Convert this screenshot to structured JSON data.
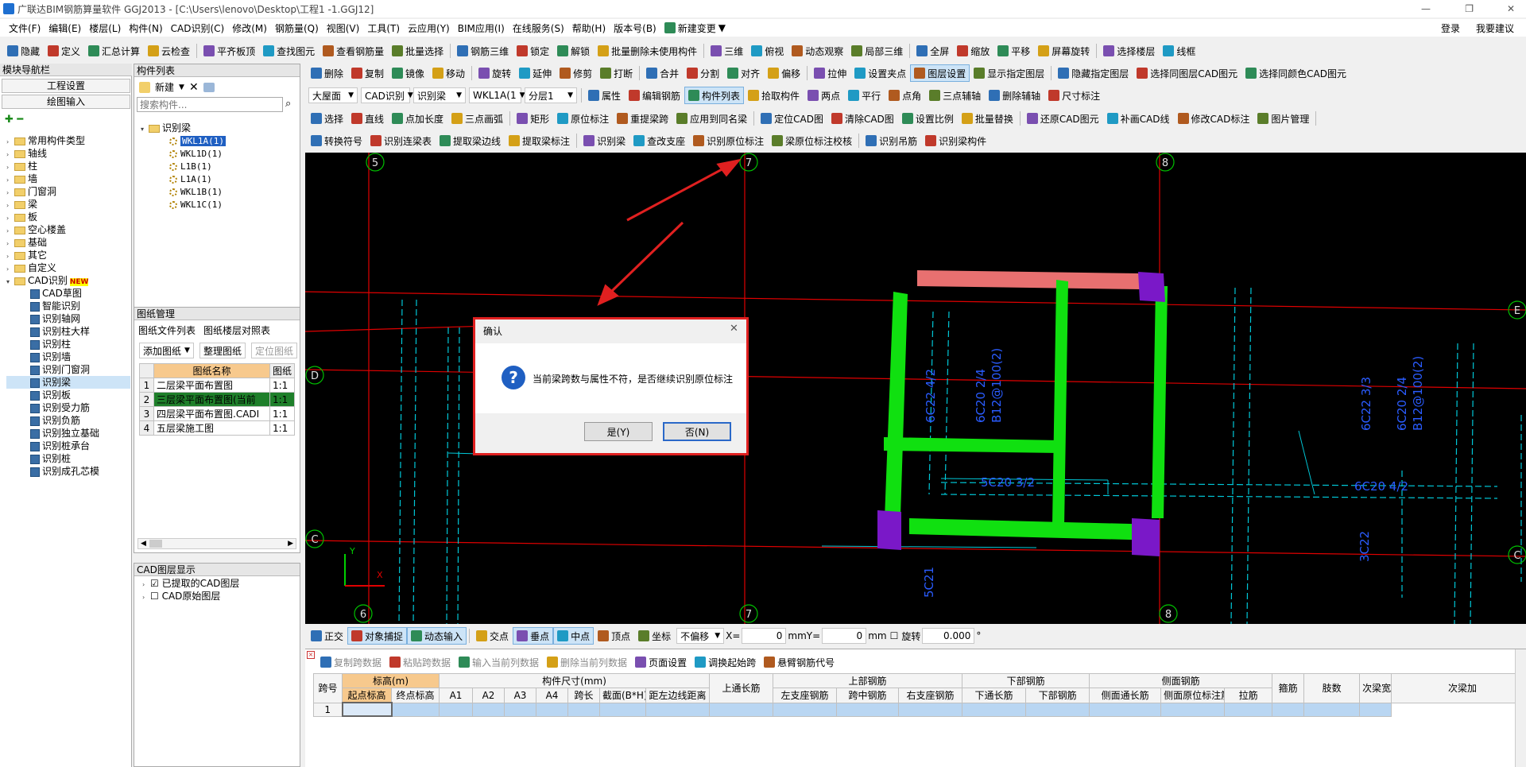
{
  "title": "广联达BIM钢筋算量软件 GGJ2013 - [C:\\Users\\lenovo\\Desktop\\工程1 -1.GGJ12]",
  "window_controls": {
    "min": "—",
    "max": "❐",
    "close": "✕"
  },
  "menu": [
    "文件(F)",
    "编辑(E)",
    "楼层(L)",
    "构件(N)",
    "CAD识别(C)",
    "修改(M)",
    "钢筋量(Q)",
    "视图(V)",
    "工具(T)",
    "云应用(Y)",
    "BIM应用(I)",
    "在线服务(S)",
    "帮助(H)",
    "版本号(B)"
  ],
  "menu_extra": "新建变更",
  "login": "登录",
  "feedback": "我要建议",
  "toolbar1": [
    "隐藏",
    "定义",
    "汇总计算",
    "云检查",
    "平齐板顶",
    "查找图元",
    "查看钢筋量",
    "批量选择",
    "钢筋三维",
    "锁定",
    "解锁",
    "批量删除未使用构件",
    "三维",
    "俯视",
    "动态观察",
    "局部三维",
    "全屏",
    "缩放",
    "平移",
    "屏幕旋转",
    "选择楼层",
    "线框"
  ],
  "toolbar2": [
    "删除",
    "复制",
    "镜像",
    "移动",
    "旋转",
    "延伸",
    "修剪",
    "打断",
    "合并",
    "分割",
    "对齐",
    "偏移",
    "拉伸",
    "设置夹点",
    "图层设置",
    "显示指定图层",
    "隐藏指定图层",
    "选择同图层CAD图元",
    "选择同颜色CAD图元"
  ],
  "toolbar3": {
    "dropdowns": [
      "大屋面",
      "CAD识别",
      "识别梁",
      "WKL1A(1",
      "分层1"
    ],
    "buttons": [
      "属性",
      "编辑钢筋",
      "构件列表",
      "拾取构件",
      "两点",
      "平行",
      "点角",
      "三点辅轴",
      "删除辅轴",
      "尺寸标注"
    ]
  },
  "toolbar4": [
    "选择",
    "直线",
    "点加长度",
    "三点画弧",
    "矩形",
    "原位标注",
    "重提梁跨",
    "应用到同名梁",
    "定位CAD图",
    "清除CAD图",
    "设置比例",
    "批量替换",
    "还原CAD图元",
    "补画CAD线",
    "修改CAD标注",
    "图片管理"
  ],
  "toolbar5": [
    "转换符号",
    "识别连梁表",
    "提取梁边线",
    "提取梁标注",
    "识别梁",
    "查改支座",
    "识别原位标注",
    "梁原位标注校核",
    "识别吊筋",
    "识别梁构件"
  ],
  "nav": {
    "title": "模块导航栏",
    "tabs": [
      "工程设置",
      "绘图输入"
    ],
    "items": [
      "常用构件类型",
      "轴线",
      "柱",
      "墙",
      "门窗洞",
      "梁",
      "板",
      "空心楼盖",
      "基础",
      "其它",
      "自定义",
      "CAD识别"
    ],
    "new_badge": "NEW",
    "cad_items": [
      "CAD草图",
      "智能识别",
      "识别轴网",
      "识别柱大样",
      "识别柱",
      "识别墙",
      "识别门窗洞",
      "识别梁",
      "识别板",
      "识别受力筋",
      "识别负筋",
      "识别独立基础",
      "识别桩承台",
      "识别桩",
      "识别成孔芯模"
    ]
  },
  "component_list": {
    "title": "构件列表",
    "new_label": "新建",
    "search_placeholder": "搜索构件...",
    "root": "识别梁",
    "items": [
      "WKL1A(1)",
      "WKL1D(1)",
      "L1B(1)",
      "L1A(1)",
      "WKL1B(1)",
      "WKL1C(1)"
    ]
  },
  "drawings": {
    "title": "图纸管理",
    "tabs": [
      "图纸文件列表",
      "图纸楼层对照表"
    ],
    "buttons": [
      "添加图纸",
      "整理图纸",
      "定位图纸"
    ],
    "headers": [
      "图纸名称",
      "图纸"
    ],
    "rows": [
      {
        "n": "1",
        "name": "二层梁平面布置图",
        "s": "1:1"
      },
      {
        "n": "2",
        "name": "三层梁平面布置图(当前",
        "s": "1:1"
      },
      {
        "n": "3",
        "name": "四层梁平面布置图.CADI",
        "s": "1:1"
      },
      {
        "n": "4",
        "name": "五层梁施工图",
        "s": "1:1"
      }
    ]
  },
  "layers": {
    "title": "CAD图层显示",
    "items": [
      "已提取的CAD图层",
      "CAD原始图层"
    ]
  },
  "canvas": {
    "axis_labels": [
      "5",
      "7",
      "8",
      "6",
      "7",
      "8",
      "D",
      "C",
      "E",
      "C"
    ],
    "annotations": [
      "6C22 4/2",
      "6C20 2/4",
      "B12@100(2)",
      "5C20 3/2",
      "6C22 3/3",
      "6C20 2/4",
      "B12@100(2)",
      "6C20 4/2",
      "5C21",
      "3C22"
    ],
    "cursor": "+"
  },
  "dialog": {
    "title": "确认",
    "message": "当前梁跨数与属性不符，是否继续识别原位标注",
    "yes": "是(Y)",
    "no": "否(N)",
    "close": "✕"
  },
  "statusbar": {
    "items": [
      "正交",
      "对象捕捉",
      "动态输入",
      "交点",
      "垂点",
      "中点",
      "顶点",
      "坐标"
    ],
    "offset": "不偏移",
    "x_label": "X=",
    "x_value": "0",
    "mm1": "mm",
    "y_label": "Y=",
    "y_value": "0",
    "mm2": "mm",
    "rotate_label": "旋转",
    "rotate_value": "0.000",
    "deg": "°"
  },
  "bottom_toolbar": [
    "复制跨数据",
    "粘贴跨数据",
    "输入当前列数据",
    "删除当前列数据",
    "页面设置",
    "调换起始跨",
    "悬臂钢筋代号"
  ],
  "span_table": {
    "h1": [
      "跨号",
      "标高(m)",
      "构件尺寸(mm)",
      "上通长筋",
      "上部钢筋",
      "下部钢筋",
      "侧面钢筋",
      "箍筋",
      "肢数",
      "次梁宽度",
      "次梁加"
    ],
    "h2": [
      "起点标高",
      "终点标高",
      "A1",
      "A2",
      "A3",
      "A4",
      "跨长",
      "截面(B*H)",
      "距左边线距离",
      "左支座钢筋",
      "跨中钢筋",
      "右支座钢筋",
      "下通长筋",
      "下部钢筋",
      "侧面通长筋",
      "侧面原位标注筋",
      "拉筋"
    ],
    "row1": "1"
  }
}
